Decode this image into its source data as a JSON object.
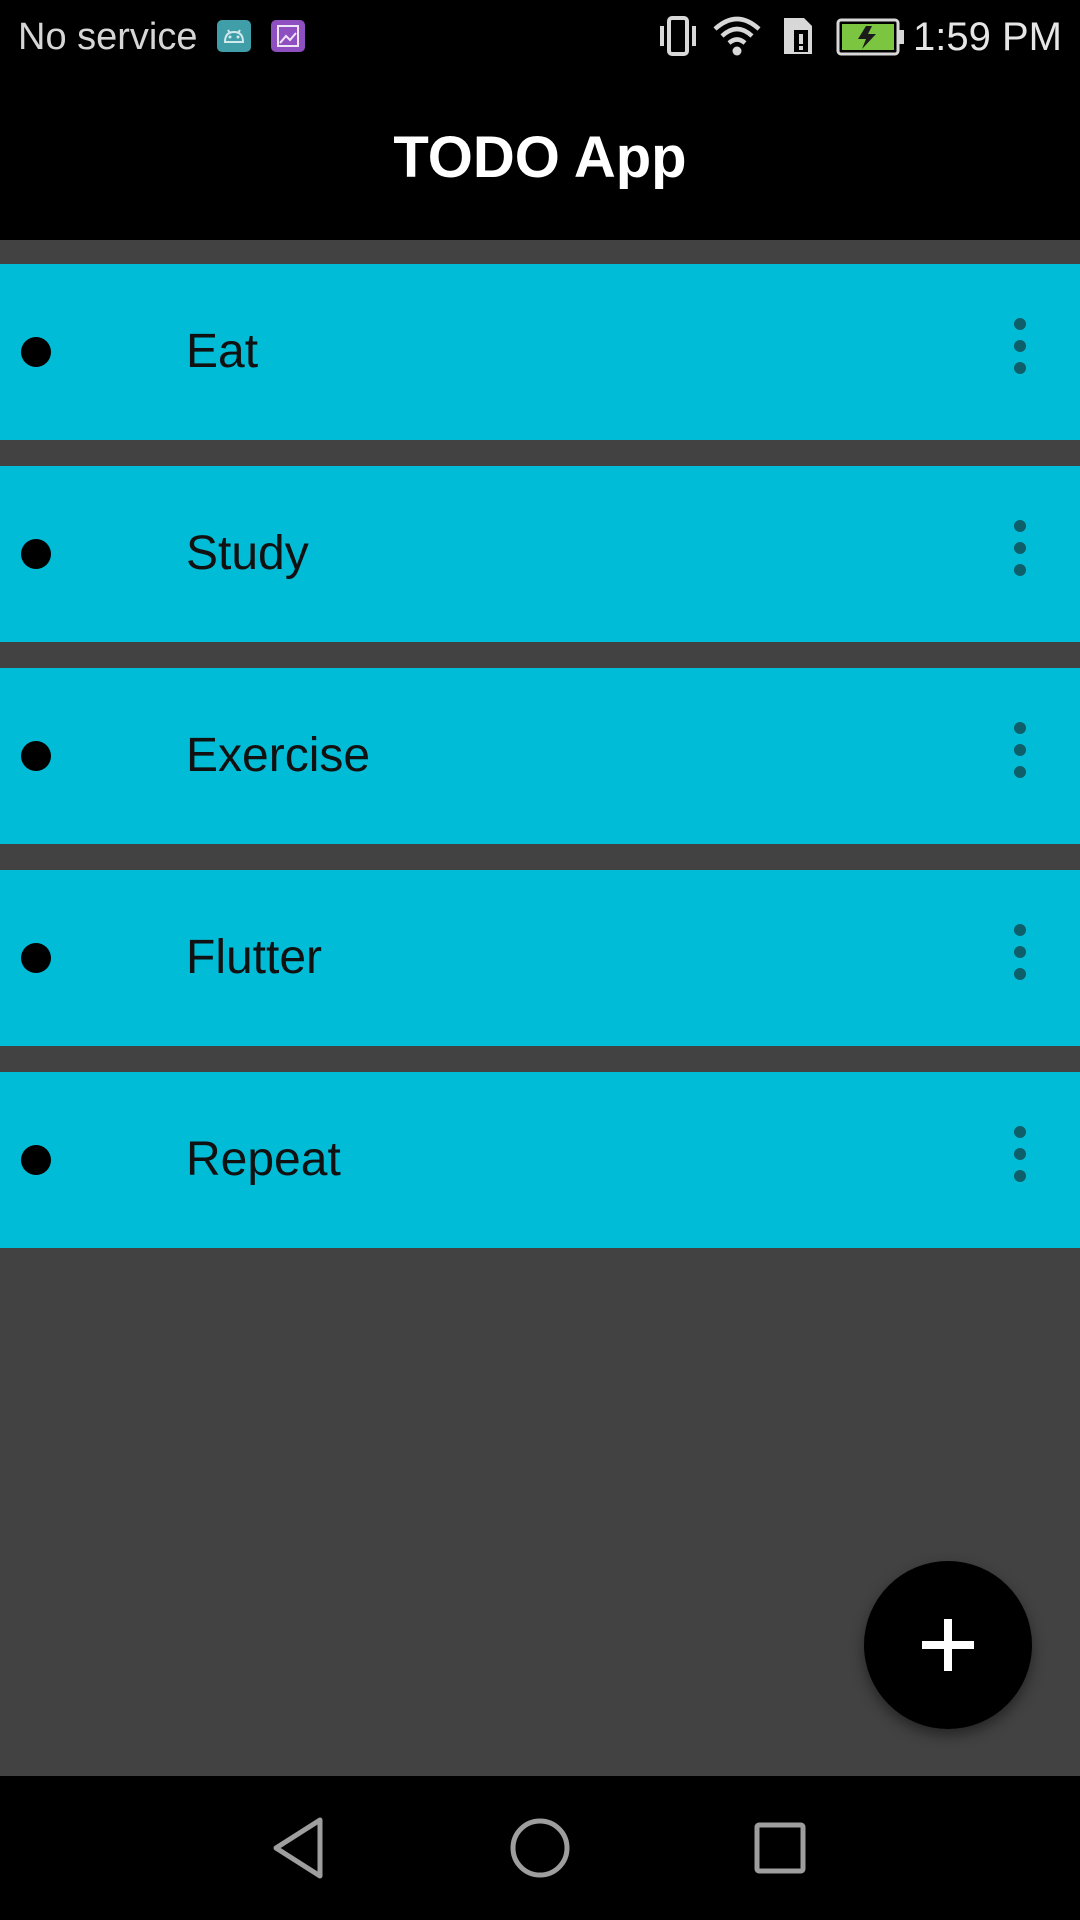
{
  "status_bar": {
    "carrier": "No service",
    "time": "1:59 PM",
    "icons": [
      "android-notification-icon",
      "gallery-notification-icon",
      "vibrate-icon",
      "wifi-icon",
      "sim-icon",
      "battery-charging-icon"
    ]
  },
  "app_bar": {
    "title": "TODO App"
  },
  "todos": [
    {
      "label": "Eat"
    },
    {
      "label": "Study"
    },
    {
      "label": "Exercise"
    },
    {
      "label": "Flutter"
    },
    {
      "label": "Repeat"
    }
  ],
  "fab": {
    "icon": "plus-icon"
  },
  "nav_bar": {
    "buttons": [
      "back-icon",
      "home-icon",
      "recents-icon"
    ]
  },
  "colors": {
    "item_background": "#00bcd6",
    "page_background": "#424242",
    "bar_background": "#000000",
    "battery_fill": "#7cc540"
  }
}
